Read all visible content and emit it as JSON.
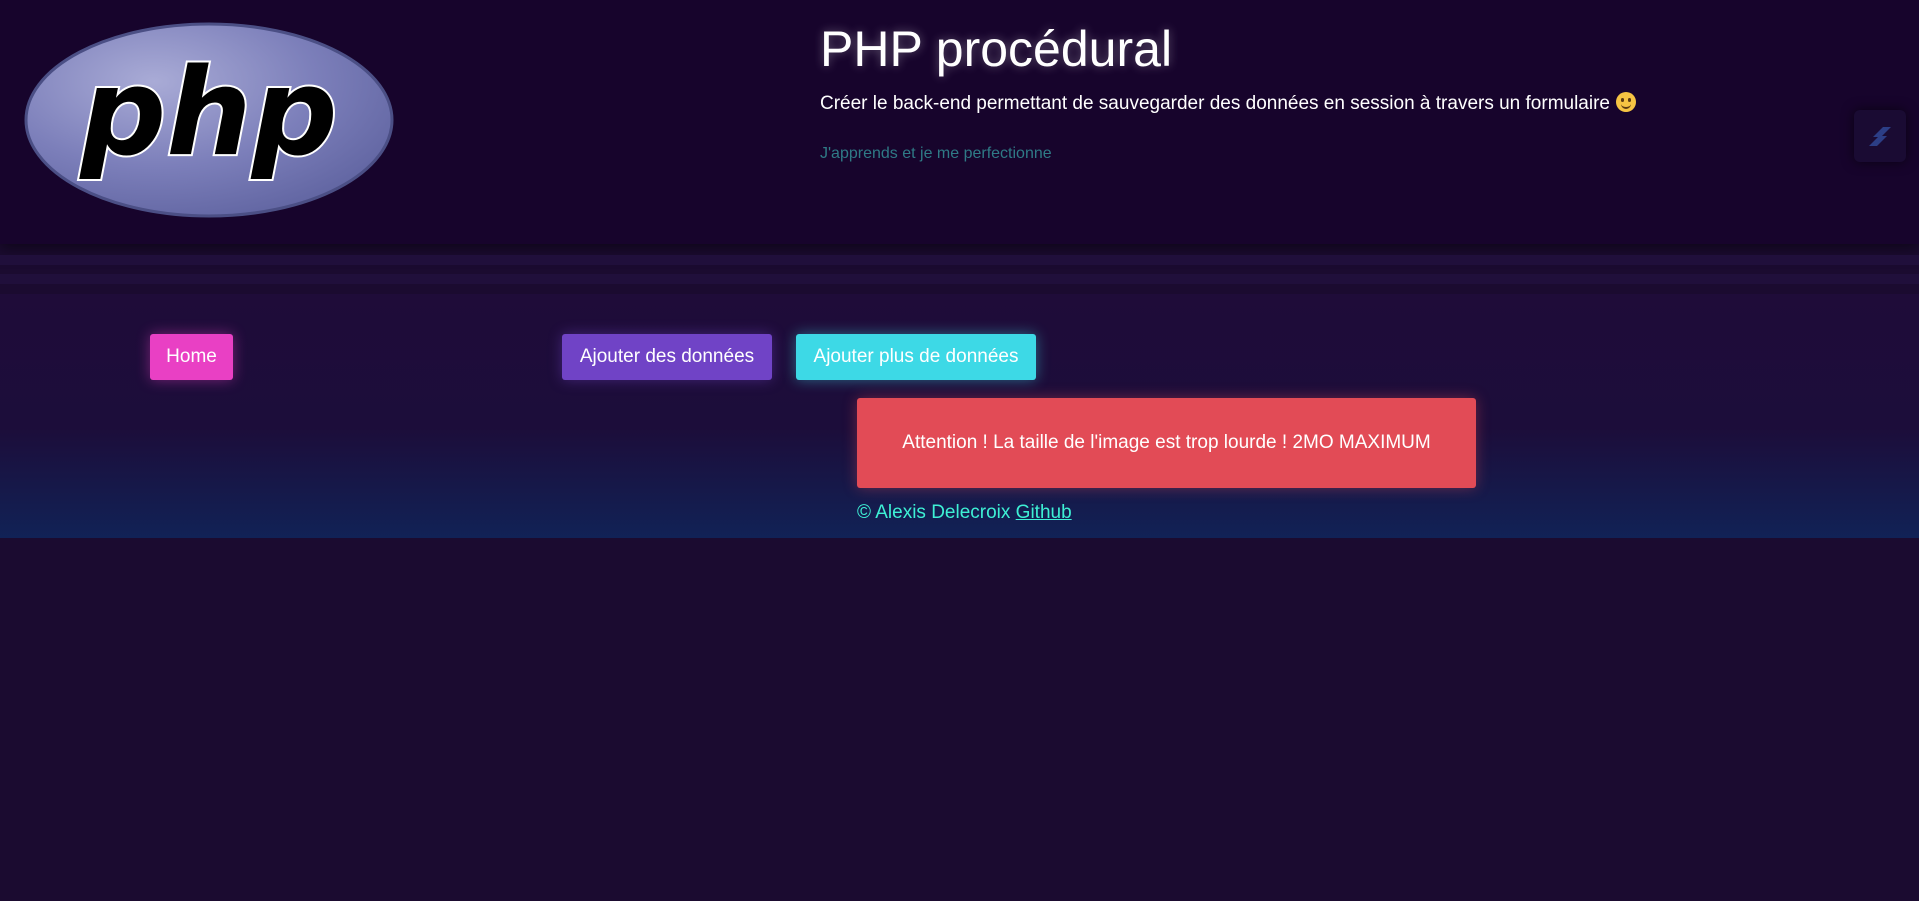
{
  "header": {
    "logo_text": "php",
    "title": "PHP procédural",
    "subtitle": "Créer le back-end permettant de sauvegarder des données en session à travers un formulaire",
    "emoji_icon": "smiling-face-icon",
    "tagline": "J'apprends et je me perfectionne",
    "side_icon": "stacked-bars-icon"
  },
  "nav": {
    "home_label": "Home",
    "add_data_label": "Ajouter des données",
    "add_more_data_label": "Ajouter plus de données"
  },
  "alert": {
    "message": "Attention ! La taille de l'image est trop lourde ! 2MO MAXIMUM"
  },
  "footer": {
    "copyright": "© Alexis Delecroix",
    "link_label": "Github"
  },
  "colors": {
    "background": "#1b0b30",
    "home_button": "#e940c4",
    "add_button": "#7043c6",
    "add_more_button": "#3dd9e6",
    "alert": "#e24b56",
    "footer_text": "#3ef0d5",
    "tagline_text": "#2f7a86"
  }
}
